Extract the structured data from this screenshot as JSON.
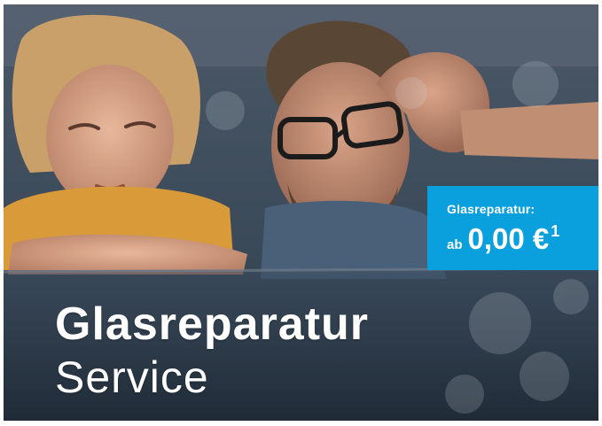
{
  "banner": {
    "headline": "Glasreparatur",
    "subline": "Service",
    "photo_subject": "child-and-man-behind-car-window"
  },
  "price_badge": {
    "label": "Glasreparatur:",
    "prefix": "ab",
    "value": "0,00 €",
    "footnote": "1",
    "background_color": "#0aa0dd"
  },
  "colors": {
    "text": "#ffffff",
    "accent": "#0aa0dd"
  }
}
